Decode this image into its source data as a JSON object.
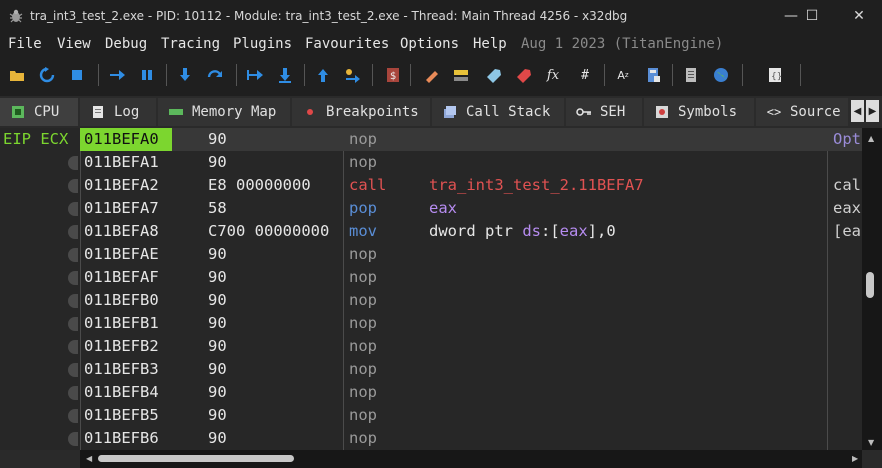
{
  "window": {
    "title": "tra_int3_test_2.exe - PID: 10112 - Module: tra_int3_test_2.exe - Thread: Main Thread 4256 - x32dbg",
    "minimize": "—",
    "maximize": "☐",
    "close": "✕"
  },
  "menu": {
    "items": [
      "File",
      "View",
      "Debug",
      "Tracing",
      "Plugins",
      "Favourites",
      "Options",
      "Help"
    ],
    "info": "Aug 1 2023 (TitanEngine)"
  },
  "tabs": [
    {
      "label": "CPU",
      "icon": "cpu-icon"
    },
    {
      "label": "Log",
      "icon": "log-icon"
    },
    {
      "label": "Memory Map",
      "icon": "memory-map-icon"
    },
    {
      "label": "Breakpoints",
      "icon": "breakpoint-icon"
    },
    {
      "label": "Call Stack",
      "icon": "call-stack-icon"
    },
    {
      "label": "SEH",
      "icon": "seh-icon"
    },
    {
      "label": "Symbols",
      "icon": "symbols-icon"
    },
    {
      "label": "Source",
      "icon": "source-icon"
    }
  ],
  "tab_nav": {
    "left": "◀",
    "right": "▶"
  },
  "disasm": {
    "left_label": "EIP ECX",
    "comment_header": "Opt",
    "rows": [
      {
        "addr": "011BEFA0",
        "bytes": "90",
        "mnemonic": "nop",
        "operands": "",
        "comment": "Opt"
      },
      {
        "addr": "011BEFA1",
        "bytes": "90",
        "mnemonic": "nop",
        "operands": "",
        "comment": ""
      },
      {
        "addr": "011BEFA2",
        "bytes": "E8 00000000",
        "mnemonic": "call",
        "operands": "tra_int3_test_2.11BEFA7",
        "comment": "cal"
      },
      {
        "addr": "011BEFA7",
        "bytes": "58",
        "mnemonic": "pop",
        "operands": "eax",
        "comment": "eax"
      },
      {
        "addr": "011BEFA8",
        "bytes": "C700 00000000",
        "mnemonic": "mov",
        "operands": "dword ptr ds:[eax],0",
        "comment": "[ea"
      },
      {
        "addr": "011BEFAE",
        "bytes": "90",
        "mnemonic": "nop",
        "operands": "",
        "comment": ""
      },
      {
        "addr": "011BEFAF",
        "bytes": "90",
        "mnemonic": "nop",
        "operands": "",
        "comment": ""
      },
      {
        "addr": "011BEFB0",
        "bytes": "90",
        "mnemonic": "nop",
        "operands": "",
        "comment": ""
      },
      {
        "addr": "011BEFB1",
        "bytes": "90",
        "mnemonic": "nop",
        "operands": "",
        "comment": ""
      },
      {
        "addr": "011BEFB2",
        "bytes": "90",
        "mnemonic": "nop",
        "operands": "",
        "comment": ""
      },
      {
        "addr": "011BEFB3",
        "bytes": "90",
        "mnemonic": "nop",
        "operands": "",
        "comment": ""
      },
      {
        "addr": "011BEFB4",
        "bytes": "90",
        "mnemonic": "nop",
        "operands": "",
        "comment": ""
      },
      {
        "addr": "011BEFB5",
        "bytes": "90",
        "mnemonic": "nop",
        "operands": "",
        "comment": ""
      },
      {
        "addr": "011BEFB6",
        "bytes": "90",
        "mnemonic": "nop",
        "operands": "",
        "comment": ""
      }
    ]
  },
  "colors": {
    "eip_highlight": "#7cd62f",
    "call": "#e05252",
    "pop": "#5a8ed6",
    "mov": "#5a8ed6",
    "call_target": "#e05252",
    "register": "#b68cf0",
    "segment": "#b68cf0",
    "address_text": "#e6e6e6"
  },
  "toolbar_icons": [
    "open-icon",
    "restart-icon",
    "stop-icon",
    "run-icon",
    "pause-icon",
    "step-into-icon",
    "step-over-icon",
    "trace-into-icon",
    "trace-over-icon",
    "execute-till-return-icon",
    "run-to-user-code-icon",
    "script-icon",
    "patch-icon",
    "comments-icon",
    "labels-icon",
    "bookmarks-icon",
    "functions-icon",
    "variables-icon",
    "strings-icon",
    "calculator-icon",
    "notes-icon",
    "globe-icon",
    "help-icon"
  ]
}
